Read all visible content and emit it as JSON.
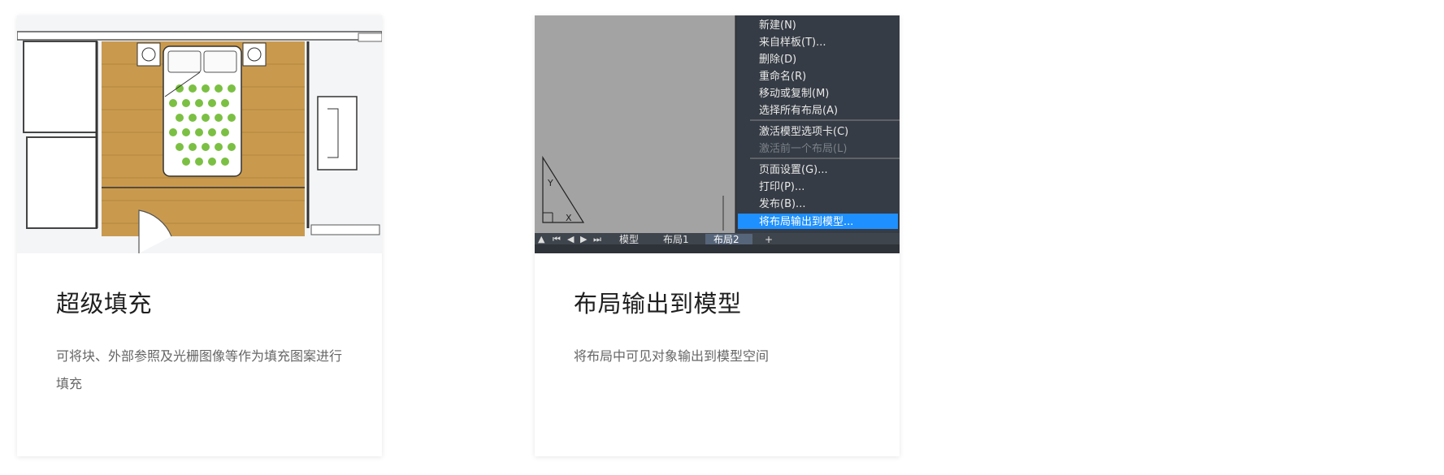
{
  "cards": [
    {
      "title": "超级填充",
      "description": "可将块、外部参照及光栅图像等作为填充图案进行填充",
      "image_icon": "floor-plan-image"
    },
    {
      "title": "布局输出到模型",
      "description": "将布局中可见对象输出到模型空间",
      "image_icon": "cad-layout-menu-image",
      "menu_items": [
        "新建(N)",
        "来自样板(T)...",
        "删除(D)",
        "重命名(R)",
        "移动或复制(M)",
        "选择所有布局(A)",
        "激活模型选项卡(C)",
        "激活前一个布局(L)",
        "页面设置(G)...",
        "打印(P)...",
        "发布(B)...",
        "将布局输出到模型..."
      ],
      "tabs": [
        "模型",
        "布局1",
        "布局2",
        "+"
      ]
    }
  ],
  "colors": {
    "wood": "#c99a4e",
    "menu_bg": "#363c45",
    "menu_highlight": "#1e90ff",
    "canvas_gray": "#a3a3a3"
  }
}
